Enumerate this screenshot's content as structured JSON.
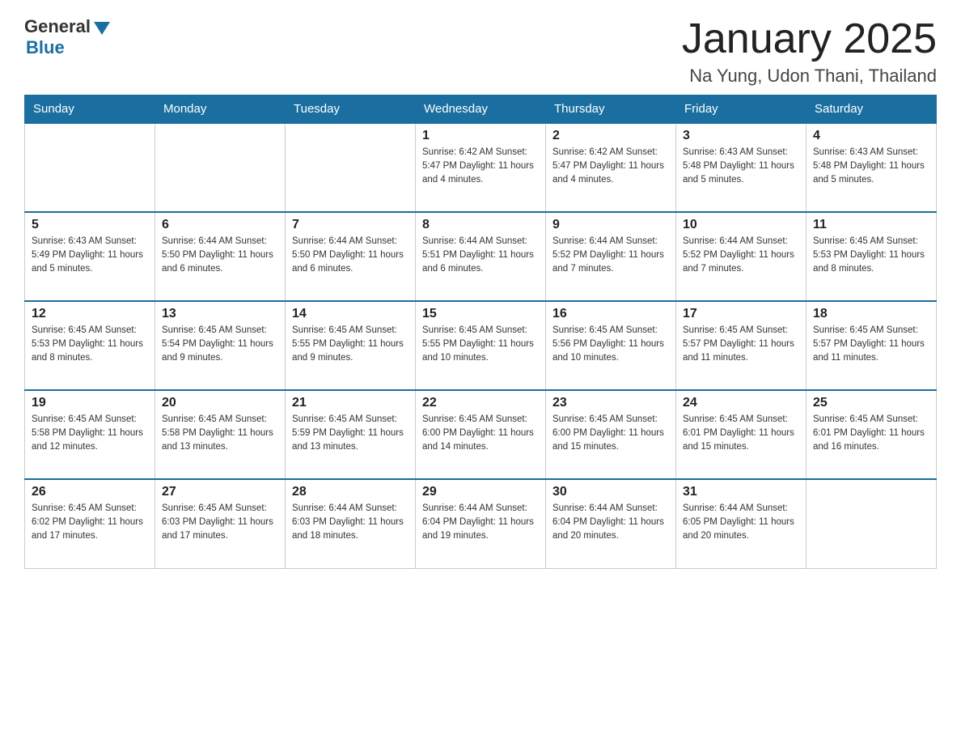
{
  "header": {
    "logo_general": "General",
    "logo_blue": "Blue",
    "month_title": "January 2025",
    "location": "Na Yung, Udon Thani, Thailand"
  },
  "days_of_week": [
    "Sunday",
    "Monday",
    "Tuesday",
    "Wednesday",
    "Thursday",
    "Friday",
    "Saturday"
  ],
  "weeks": [
    [
      {
        "day": "",
        "info": ""
      },
      {
        "day": "",
        "info": ""
      },
      {
        "day": "",
        "info": ""
      },
      {
        "day": "1",
        "info": "Sunrise: 6:42 AM\nSunset: 5:47 PM\nDaylight: 11 hours\nand 4 minutes."
      },
      {
        "day": "2",
        "info": "Sunrise: 6:42 AM\nSunset: 5:47 PM\nDaylight: 11 hours\nand 4 minutes."
      },
      {
        "day": "3",
        "info": "Sunrise: 6:43 AM\nSunset: 5:48 PM\nDaylight: 11 hours\nand 5 minutes."
      },
      {
        "day": "4",
        "info": "Sunrise: 6:43 AM\nSunset: 5:48 PM\nDaylight: 11 hours\nand 5 minutes."
      }
    ],
    [
      {
        "day": "5",
        "info": "Sunrise: 6:43 AM\nSunset: 5:49 PM\nDaylight: 11 hours\nand 5 minutes."
      },
      {
        "day": "6",
        "info": "Sunrise: 6:44 AM\nSunset: 5:50 PM\nDaylight: 11 hours\nand 6 minutes."
      },
      {
        "day": "7",
        "info": "Sunrise: 6:44 AM\nSunset: 5:50 PM\nDaylight: 11 hours\nand 6 minutes."
      },
      {
        "day": "8",
        "info": "Sunrise: 6:44 AM\nSunset: 5:51 PM\nDaylight: 11 hours\nand 6 minutes."
      },
      {
        "day": "9",
        "info": "Sunrise: 6:44 AM\nSunset: 5:52 PM\nDaylight: 11 hours\nand 7 minutes."
      },
      {
        "day": "10",
        "info": "Sunrise: 6:44 AM\nSunset: 5:52 PM\nDaylight: 11 hours\nand 7 minutes."
      },
      {
        "day": "11",
        "info": "Sunrise: 6:45 AM\nSunset: 5:53 PM\nDaylight: 11 hours\nand 8 minutes."
      }
    ],
    [
      {
        "day": "12",
        "info": "Sunrise: 6:45 AM\nSunset: 5:53 PM\nDaylight: 11 hours\nand 8 minutes."
      },
      {
        "day": "13",
        "info": "Sunrise: 6:45 AM\nSunset: 5:54 PM\nDaylight: 11 hours\nand 9 minutes."
      },
      {
        "day": "14",
        "info": "Sunrise: 6:45 AM\nSunset: 5:55 PM\nDaylight: 11 hours\nand 9 minutes."
      },
      {
        "day": "15",
        "info": "Sunrise: 6:45 AM\nSunset: 5:55 PM\nDaylight: 11 hours\nand 10 minutes."
      },
      {
        "day": "16",
        "info": "Sunrise: 6:45 AM\nSunset: 5:56 PM\nDaylight: 11 hours\nand 10 minutes."
      },
      {
        "day": "17",
        "info": "Sunrise: 6:45 AM\nSunset: 5:57 PM\nDaylight: 11 hours\nand 11 minutes."
      },
      {
        "day": "18",
        "info": "Sunrise: 6:45 AM\nSunset: 5:57 PM\nDaylight: 11 hours\nand 11 minutes."
      }
    ],
    [
      {
        "day": "19",
        "info": "Sunrise: 6:45 AM\nSunset: 5:58 PM\nDaylight: 11 hours\nand 12 minutes."
      },
      {
        "day": "20",
        "info": "Sunrise: 6:45 AM\nSunset: 5:58 PM\nDaylight: 11 hours\nand 13 minutes."
      },
      {
        "day": "21",
        "info": "Sunrise: 6:45 AM\nSunset: 5:59 PM\nDaylight: 11 hours\nand 13 minutes."
      },
      {
        "day": "22",
        "info": "Sunrise: 6:45 AM\nSunset: 6:00 PM\nDaylight: 11 hours\nand 14 minutes."
      },
      {
        "day": "23",
        "info": "Sunrise: 6:45 AM\nSunset: 6:00 PM\nDaylight: 11 hours\nand 15 minutes."
      },
      {
        "day": "24",
        "info": "Sunrise: 6:45 AM\nSunset: 6:01 PM\nDaylight: 11 hours\nand 15 minutes."
      },
      {
        "day": "25",
        "info": "Sunrise: 6:45 AM\nSunset: 6:01 PM\nDaylight: 11 hours\nand 16 minutes."
      }
    ],
    [
      {
        "day": "26",
        "info": "Sunrise: 6:45 AM\nSunset: 6:02 PM\nDaylight: 11 hours\nand 17 minutes."
      },
      {
        "day": "27",
        "info": "Sunrise: 6:45 AM\nSunset: 6:03 PM\nDaylight: 11 hours\nand 17 minutes."
      },
      {
        "day": "28",
        "info": "Sunrise: 6:44 AM\nSunset: 6:03 PM\nDaylight: 11 hours\nand 18 minutes."
      },
      {
        "day": "29",
        "info": "Sunrise: 6:44 AM\nSunset: 6:04 PM\nDaylight: 11 hours\nand 19 minutes."
      },
      {
        "day": "30",
        "info": "Sunrise: 6:44 AM\nSunset: 6:04 PM\nDaylight: 11 hours\nand 20 minutes."
      },
      {
        "day": "31",
        "info": "Sunrise: 6:44 AM\nSunset: 6:05 PM\nDaylight: 11 hours\nand 20 minutes."
      },
      {
        "day": "",
        "info": ""
      }
    ]
  ]
}
